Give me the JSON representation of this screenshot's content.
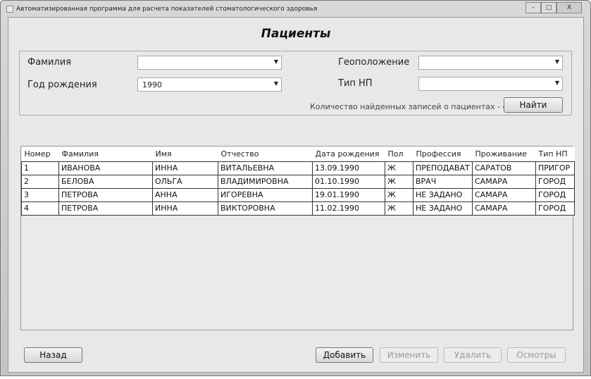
{
  "window": {
    "title": "Автоматизированная программа для расчета показателей стоматологического здоровья",
    "min": "–",
    "max": "□",
    "close": "X"
  },
  "page_title": "Пациенты",
  "filters": {
    "surname_label": "Фамилия",
    "surname_value": "",
    "birth_year_label": "Год рождения",
    "birth_year_value": "1990",
    "geo_label": "Геоположение",
    "geo_value": "",
    "settlement_label": "Тип НП",
    "settlement_value": "",
    "count_text": "Количество найденных записей о пациентах - 4",
    "find_button": "Найти"
  },
  "table": {
    "columns": [
      "Номер",
      "Фамилия",
      "Имя",
      "Отчество",
      "Дата рождения",
      "Пол",
      "Профессия",
      "Проживание",
      "Тип НП"
    ],
    "rows": [
      [
        "1",
        "ИВАНОВА",
        "ИННА",
        "ВИТАЛЬЕВНА",
        "13.09.1990",
        "Ж",
        "ПРЕПОДАВАТ",
        "САРАТОВ",
        "ПРИГОР"
      ],
      [
        "2",
        "БЕЛОВА",
        "ОЛЬГА",
        "ВЛАДИМИРОВНА",
        "01.10.1990",
        "Ж",
        "ВРАЧ",
        "САМАРА",
        "ГОРОД"
      ],
      [
        "3",
        "ПЕТРОВА",
        "АННА",
        "ИГОРЕВНА",
        "19.01.1990",
        "Ж",
        "НЕ ЗАДАНО",
        "САМАРА",
        "ГОРОД"
      ],
      [
        "4",
        "ПЕТРОВА",
        "ИННА",
        "ВИКТОРОВНА",
        "11.02.1990",
        "Ж",
        "НЕ ЗАДАНО",
        "САМАРА",
        "ГОРОД"
      ]
    ]
  },
  "buttons": {
    "back": "Назад",
    "add": "Добавить",
    "edit": "Изменить",
    "delete": "Удалить",
    "exams": "Осмотры"
  }
}
